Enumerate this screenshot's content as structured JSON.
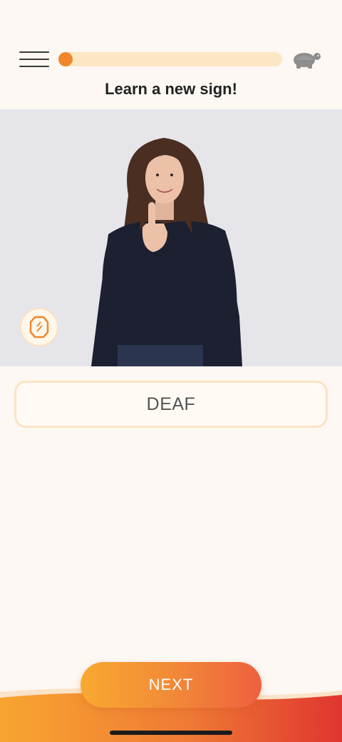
{
  "header": {
    "menu_icon": "hamburger-menu-icon",
    "progress_fraction": 0.03,
    "speed_icon": "turtle-icon"
  },
  "title": "Learn a new sign!",
  "video": {
    "mirror_icon": "mirror-icon"
  },
  "answer": {
    "word": "DEAF"
  },
  "footer": {
    "next_label": "NEXT"
  },
  "colors": {
    "accent": "#f0872c",
    "progress_track": "#fde6c4",
    "background": "#fdf8f3",
    "gradient_start": "#f8a930",
    "gradient_end": "#e0352f"
  }
}
